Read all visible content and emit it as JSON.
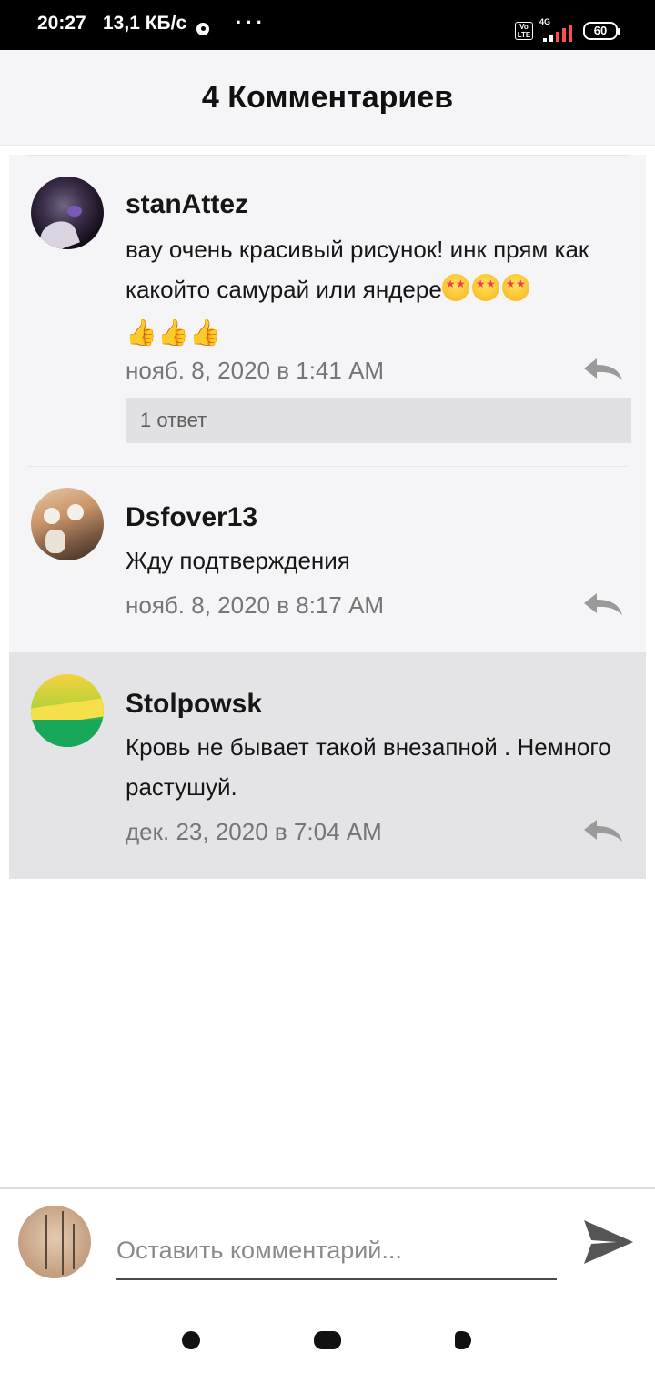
{
  "status_bar": {
    "time": "20:27",
    "speed": "13,1 КБ/с",
    "more": "···",
    "volte": "Vo LTE",
    "network": "4G",
    "battery": "60"
  },
  "header": {
    "title": "4 Комментариев"
  },
  "comments": [
    {
      "author": "stanAttez",
      "text": "вау очень красивый рисунок! инк прям как какойто самурай или яндере",
      "emoji_star_count": 3,
      "emoji_thumb_count": 3,
      "timestamp": "нояб. 8, 2020 в 1:41 AM",
      "replies_label": "1 ответ"
    },
    {
      "author": "Dsfover13",
      "text": "Жду подтверждения",
      "timestamp": "нояб. 8, 2020 в 8:17 AM"
    },
    {
      "author": "Stolpowsk",
      "text": "Кровь не бывает такой внезапной . Немного растушуй.",
      "timestamp": "дек. 23, 2020 в 7:04 AM"
    }
  ],
  "input": {
    "placeholder": "Оставить комментарий..."
  },
  "icons": {
    "reply": "reply-icon",
    "send": "send-icon",
    "nav": [
      "nav-back-icon",
      "nav-home-icon",
      "nav-recent-icon"
    ]
  },
  "colors": {
    "comment_bg": "#f5f4f6",
    "highlight_bg": "#e4e3e5",
    "timestamp": "#767676",
    "icon_gray": "#9a9a9a",
    "send": "#555555"
  }
}
